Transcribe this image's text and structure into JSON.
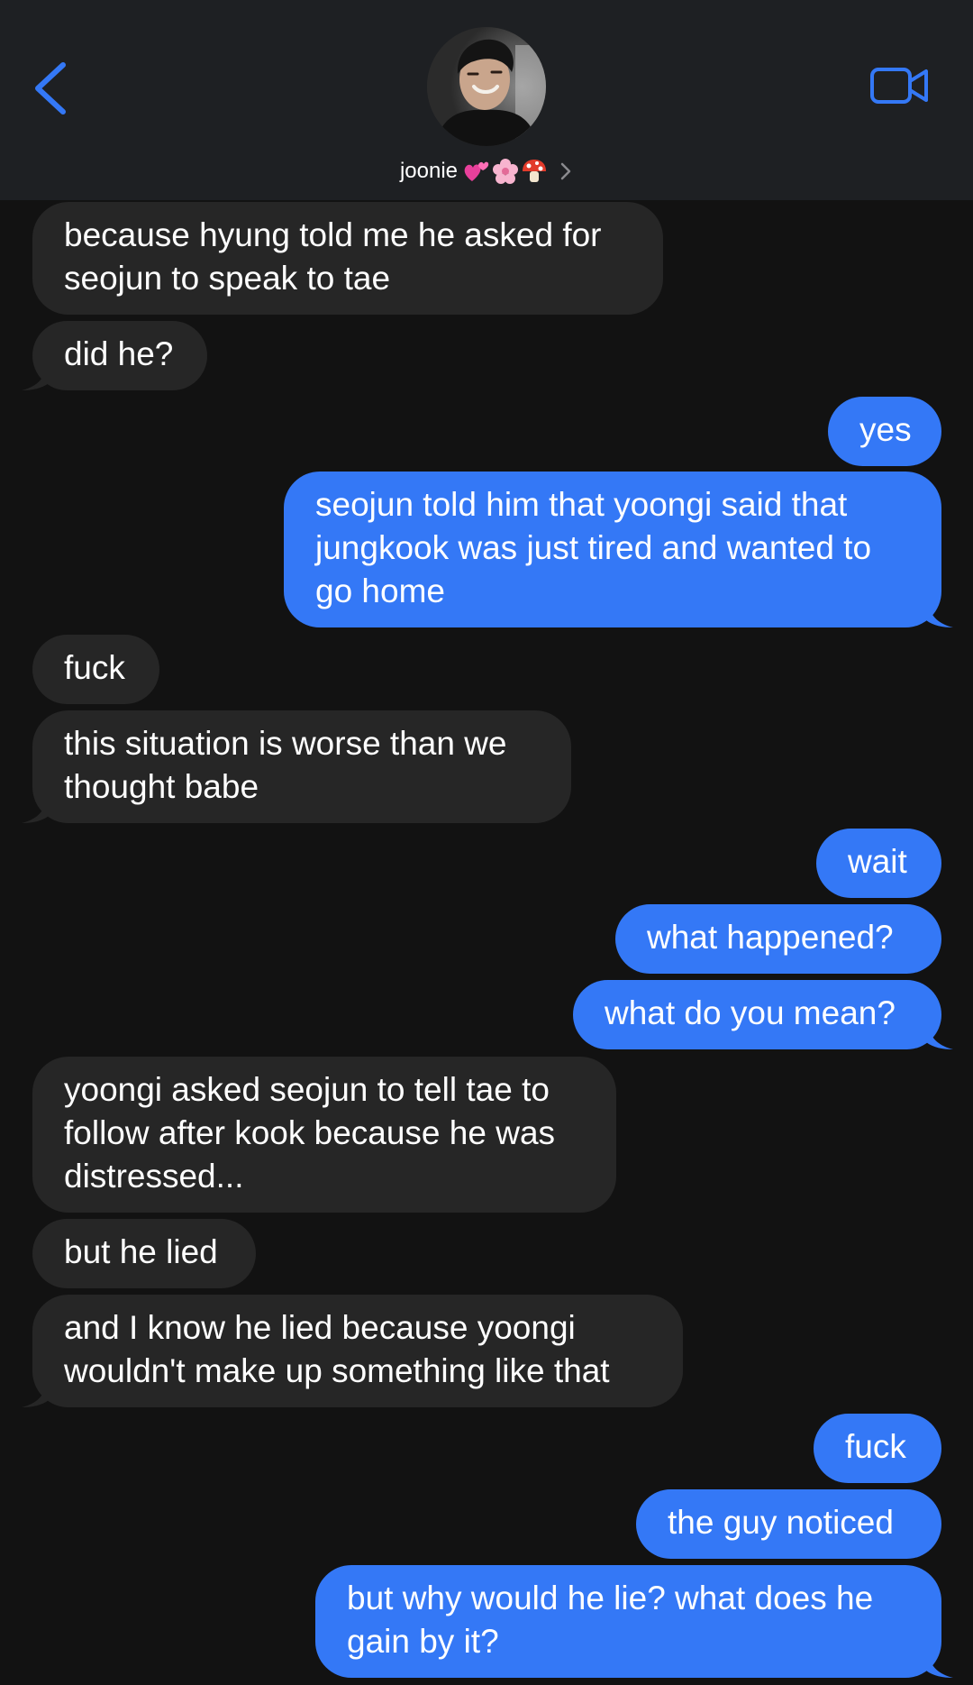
{
  "header": {
    "contact_name": "joonie",
    "emojis": [
      "two-hearts-emoji",
      "cherry-blossom-emoji",
      "mushroom-emoji"
    ]
  },
  "colors": {
    "background": "#121212",
    "header_bg": "#1e2023",
    "incoming_bubble": "#262626",
    "outgoing_bubble": "#3478f6",
    "accent": "#3478f6"
  },
  "messages": [
    {
      "from": "them",
      "lines": [
        "because hyung told me he asked for",
        "seojun to speak to tae"
      ]
    },
    {
      "from": "them",
      "lines": [
        "did he?"
      ]
    },
    {
      "from": "me",
      "lines": [
        "yes"
      ]
    },
    {
      "from": "me",
      "lines": [
        "seojun told him that yoongi said that",
        "jungkook was just tired and wanted to",
        "go home"
      ]
    },
    {
      "from": "them",
      "lines": [
        "fuck"
      ]
    },
    {
      "from": "them",
      "lines": [
        "this situation is worse than we",
        "thought babe"
      ]
    },
    {
      "from": "me",
      "lines": [
        "wait"
      ]
    },
    {
      "from": "me",
      "lines": [
        "what happened?"
      ]
    },
    {
      "from": "me",
      "lines": [
        "what do you mean?"
      ]
    },
    {
      "from": "them",
      "lines": [
        "yoongi asked seojun to tell tae to",
        "follow after kook because he was",
        "distressed..."
      ]
    },
    {
      "from": "them",
      "lines": [
        "but he lied"
      ]
    },
    {
      "from": "them",
      "lines": [
        "and I know he lied because yoongi",
        "wouldn't make up something like that"
      ]
    },
    {
      "from": "me",
      "lines": [
        "fuck"
      ]
    },
    {
      "from": "me",
      "lines": [
        "the guy noticed"
      ]
    },
    {
      "from": "me",
      "lines": [
        "but why would he lie? what does he",
        "gain by it?"
      ]
    }
  ]
}
